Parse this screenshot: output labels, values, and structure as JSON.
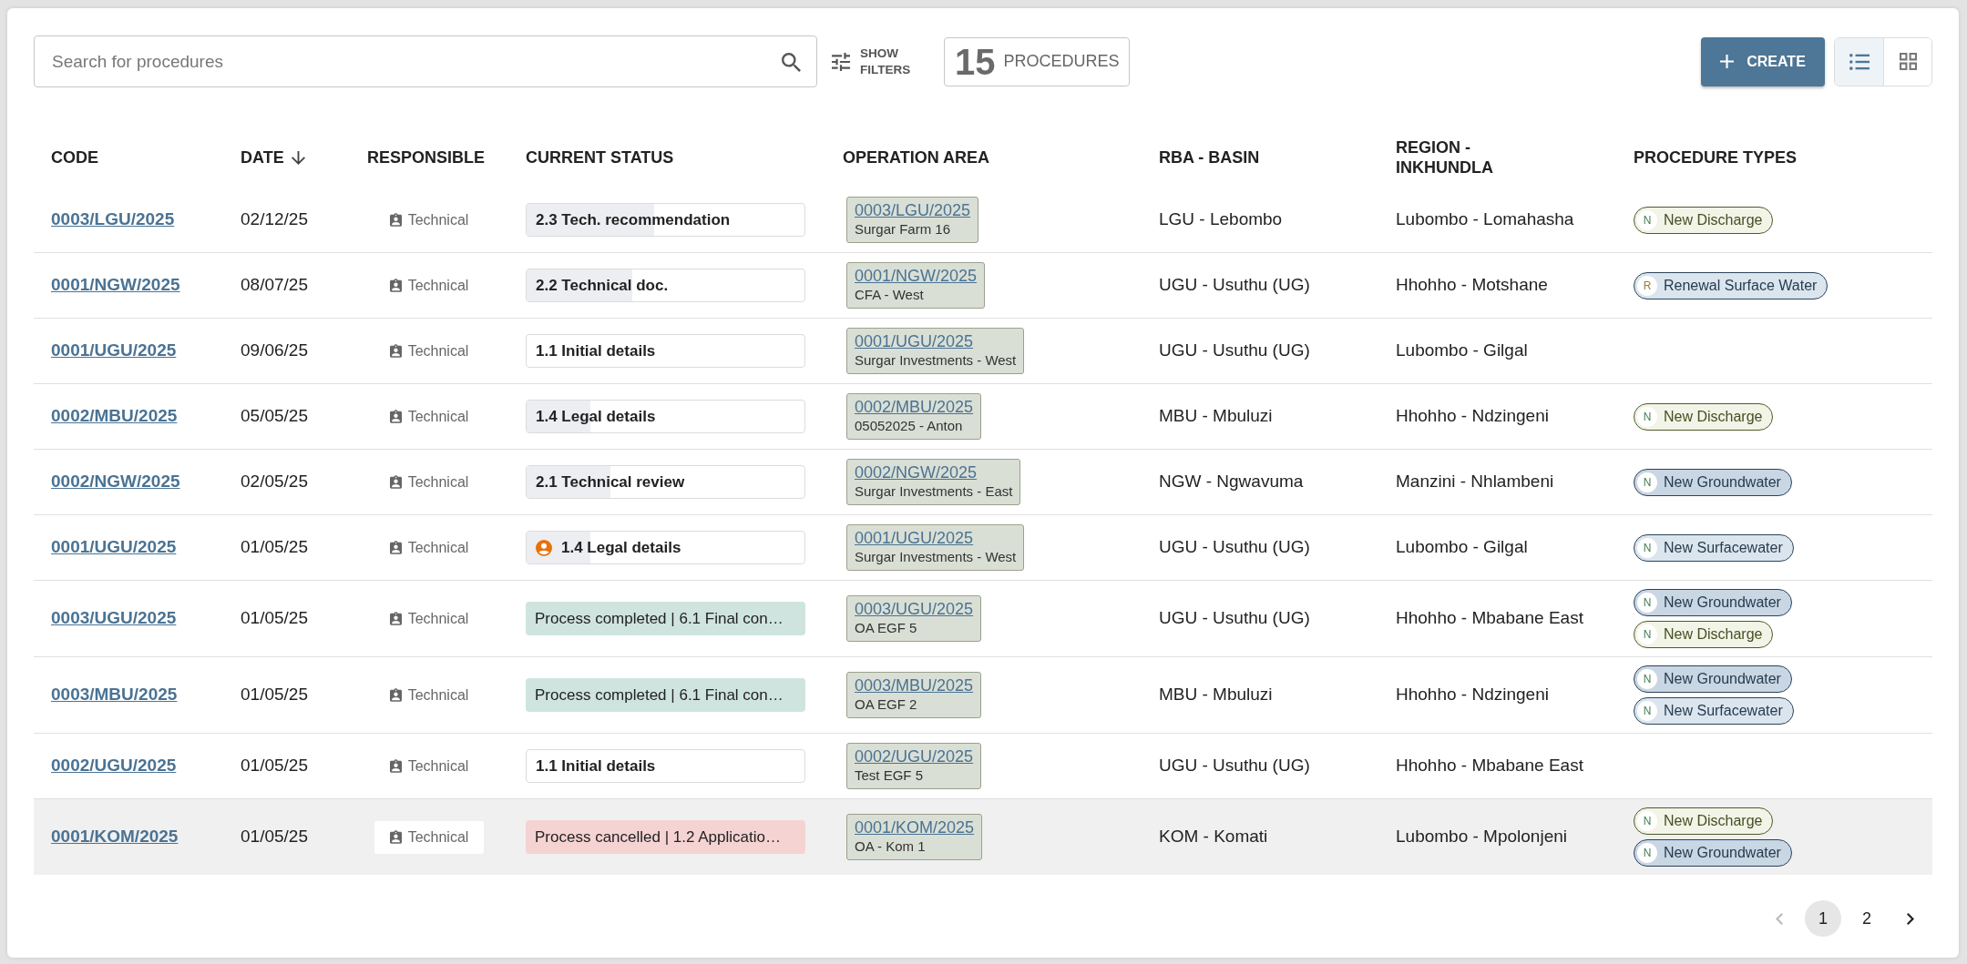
{
  "search": {
    "placeholder": "Search for procedures"
  },
  "filters_button": {
    "label": "SHOW FILTERS"
  },
  "count": {
    "number": "15",
    "label": "PROCEDURES"
  },
  "create_button": {
    "label": "CREATE"
  },
  "view_modes": [
    {
      "kind": "list",
      "selected": true
    },
    {
      "kind": "grid",
      "selected": false
    }
  ],
  "table": {
    "columns": [
      {
        "label": "CODE",
        "sorted": false
      },
      {
        "label": "DATE",
        "sorted": true
      },
      {
        "label": "RESPONSIBLE",
        "sorted": false
      },
      {
        "label": "CURRENT STATUS",
        "sorted": false
      },
      {
        "label": "OPERATION AREA",
        "sorted": false
      },
      {
        "label": "RBA - BASIN",
        "sorted": false
      },
      {
        "label": "REGION - INKHUNDLA",
        "sorted": false
      },
      {
        "label": "PROCEDURE TYPES",
        "sorted": false
      }
    ],
    "rows": [
      {
        "code": "0003/LGU/2025",
        "date": "02/12/25",
        "responsible": "Technical",
        "status": {
          "kind": "progress",
          "text": "2.3 Tech. recommendation",
          "level": 0.46,
          "assigned": false
        },
        "operation_area": {
          "code": "0003/LGU/2025",
          "name": "Surgar Farm 16"
        },
        "basin": "LGU - Lebombo",
        "region": "Lubombo - Lomahasha",
        "procedure_types": [
          {
            "kind": "new",
            "letter": "N",
            "label": "New Discharge",
            "color": "#f1f4e6"
          }
        ],
        "highlighted": false
      },
      {
        "code": "0001/NGW/2025",
        "date": "08/07/25",
        "responsible": "Technical",
        "status": {
          "kind": "progress",
          "text": "2.2 Technical doc.",
          "level": 0.38,
          "assigned": false
        },
        "operation_area": {
          "code": "0001/NGW/2025",
          "name": "CFA - West"
        },
        "basin": "UGU - Usuthu (UG)",
        "region": "Hhohho - Motshane",
        "procedure_types": [
          {
            "kind": "renewal",
            "letter": "R",
            "label": "Renewal Surface Water",
            "color": "#dbe5ee"
          }
        ],
        "highlighted": false
      },
      {
        "code": "0001/UGU/2025",
        "date": "09/06/25",
        "responsible": "Technical",
        "status": {
          "kind": "progress",
          "text": "1.1 Initial details",
          "assigned": false
        },
        "operation_area": {
          "code": "0001/UGU/2025",
          "name": "Surgar Investments - West"
        },
        "basin": "UGU - Usuthu (UG)",
        "region": "Lubombo - Gilgal",
        "highlighted": false
      },
      {
        "code": "0002/MBU/2025",
        "date": "05/05/25",
        "responsible": "Technical",
        "status": {
          "kind": "progress",
          "text": "1.4 Legal details",
          "level": 0.23,
          "assigned": false
        },
        "operation_area": {
          "code": "0002/MBU/2025",
          "name": "05052025 - Anton"
        },
        "basin": "MBU - Mbuluzi",
        "region": "Hhohho - Ndzingeni",
        "procedure_types": [
          {
            "kind": "new",
            "letter": "N",
            "label": "New Discharge",
            "color": "#f1f4e6"
          }
        ],
        "highlighted": false
      },
      {
        "code": "0002/NGW/2025",
        "date": "02/05/25",
        "responsible": "Technical",
        "status": {
          "kind": "progress",
          "text": "2.1 Technical review",
          "level": 0.3,
          "assigned": false
        },
        "operation_area": {
          "code": "0002/NGW/2025",
          "name": "Surgar Investments - East"
        },
        "basin": "NGW - Ngwavuma",
        "region": "Manzini - Nhlambeni",
        "procedure_types": [
          {
            "kind": "new",
            "letter": "N",
            "label": "New Groundwater",
            "color": "#c9d6e3"
          }
        ],
        "highlighted": false
      },
      {
        "code": "0001/UGU/2025",
        "date": "01/05/25",
        "responsible": "Technical",
        "status": {
          "kind": "progress",
          "text": "1.4 Legal details",
          "level": 0.23,
          "assigned": true
        },
        "operation_area": {
          "code": "0001/UGU/2025",
          "name": "Surgar Investments - West"
        },
        "basin": "UGU - Usuthu (UG)",
        "region": "Lubombo - Gilgal",
        "procedure_types": [
          {
            "kind": "new",
            "letter": "N",
            "label": "New Surfacewater",
            "color": "#dbe5ee"
          }
        ],
        "highlighted": false
      },
      {
        "code": "0003/UGU/2025",
        "date": "01/05/25",
        "responsible": "Technical",
        "status": {
          "kind": "completed",
          "text": "Process completed | 6.1 Final con…",
          "assigned": false
        },
        "operation_area": {
          "code": "0003/UGU/2025",
          "name": "OA EGF 5"
        },
        "basin": "UGU - Usuthu (UG)",
        "region": "Hhohho - Mbabane East",
        "procedure_types": [
          {
            "kind": "new",
            "letter": "N",
            "label": "New Groundwater",
            "color": "#c9d6e3"
          },
          {
            "kind": "new",
            "letter": "N",
            "label": "New Discharge",
            "color": "#f1f4e6"
          }
        ],
        "highlighted": false
      },
      {
        "code": "0003/MBU/2025",
        "date": "01/05/25",
        "responsible": "Technical",
        "status": {
          "kind": "completed",
          "text": "Process completed | 6.1 Final con…",
          "assigned": false
        },
        "operation_area": {
          "code": "0003/MBU/2025",
          "name": "OA EGF 2"
        },
        "basin": "MBU - Mbuluzi",
        "region": "Hhohho - Ndzingeni",
        "procedure_types": [
          {
            "kind": "new",
            "letter": "N",
            "label": "New Groundwater",
            "color": "#c9d6e3"
          },
          {
            "kind": "new",
            "letter": "N",
            "label": "New Surfacewater",
            "color": "#dbe5ee"
          }
        ],
        "highlighted": false
      },
      {
        "code": "0002/UGU/2025",
        "date": "01/05/25",
        "responsible": "Technical",
        "status": {
          "kind": "progress",
          "text": "1.1 Initial details",
          "assigned": false
        },
        "operation_area": {
          "code": "0002/UGU/2025",
          "name": "Test EGF 5"
        },
        "basin": "UGU - Usuthu (UG)",
        "region": "Hhohho - Mbabane East",
        "highlighted": false
      },
      {
        "code": "0001/KOM/2025",
        "date": "01/05/25",
        "responsible": "Technical",
        "status": {
          "kind": "cancelled",
          "text": "Process cancelled | 1.2 Applicatio…",
          "assigned": false
        },
        "operation_area": {
          "code": "0001/KOM/2025",
          "name": "OA - Kom 1"
        },
        "basin": "KOM - Komati",
        "region": "Lubombo - Mpolonjeni",
        "procedure_types": [
          {
            "kind": "new",
            "letter": "N",
            "label": "New Discharge",
            "color": "#f1f4e6"
          },
          {
            "kind": "new",
            "letter": "N",
            "label": "New Groundwater",
            "color": "#c9d6e3"
          }
        ],
        "highlighted": true
      }
    ]
  },
  "pagination": {
    "previous": {
      "disabled": true
    },
    "pages": [
      {
        "label": "1",
        "selected": true
      },
      {
        "label": "2",
        "selected": false
      }
    ],
    "next": {
      "disabled": false
    }
  }
}
